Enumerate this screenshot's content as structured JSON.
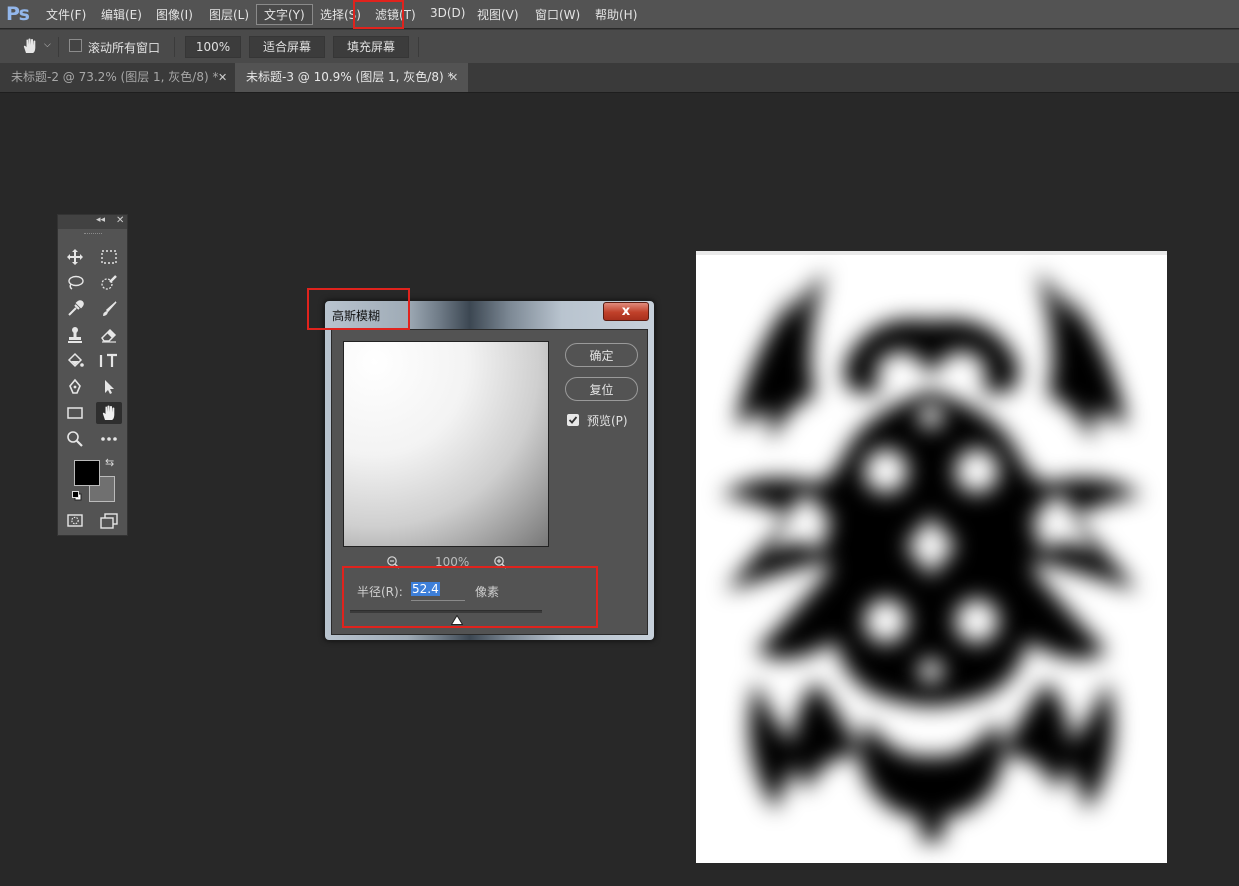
{
  "app": {
    "logo": "Ps"
  },
  "menu": [
    {
      "label": "文件(F)"
    },
    {
      "label": "编辑(E)"
    },
    {
      "label": "图像(I)"
    },
    {
      "label": "图层(L)"
    },
    {
      "label": "文字(Y)"
    },
    {
      "label": "选择(S)"
    },
    {
      "label": "滤镜(T)"
    },
    {
      "label": "3D(D)"
    },
    {
      "label": "视图(V)"
    },
    {
      "label": "窗口(W)"
    },
    {
      "label": "帮助(H)"
    }
  ],
  "options": {
    "scroll_all_label": "滚动所有窗口",
    "zoom_value": "100%",
    "fit_screen": "适合屏幕",
    "fill_screen": "填充屏幕"
  },
  "tabs": [
    {
      "label": "未标题-2 @ 73.2% (图层 1, 灰色/8) *",
      "active": false
    },
    {
      "label": "未标题-3 @ 10.9% (图层 1, 灰色/8) *",
      "active": true
    }
  ],
  "dialog": {
    "title": "高斯模糊",
    "close": "x",
    "ok": "确定",
    "reset": "复位",
    "preview_label": "预览(P)",
    "zoom_level": "100%",
    "radius_label": "半径(R):",
    "radius_value": "52.4",
    "unit": "像素"
  },
  "colors": {
    "annotation": "#e0231d",
    "accent": "#3d7fd9"
  }
}
